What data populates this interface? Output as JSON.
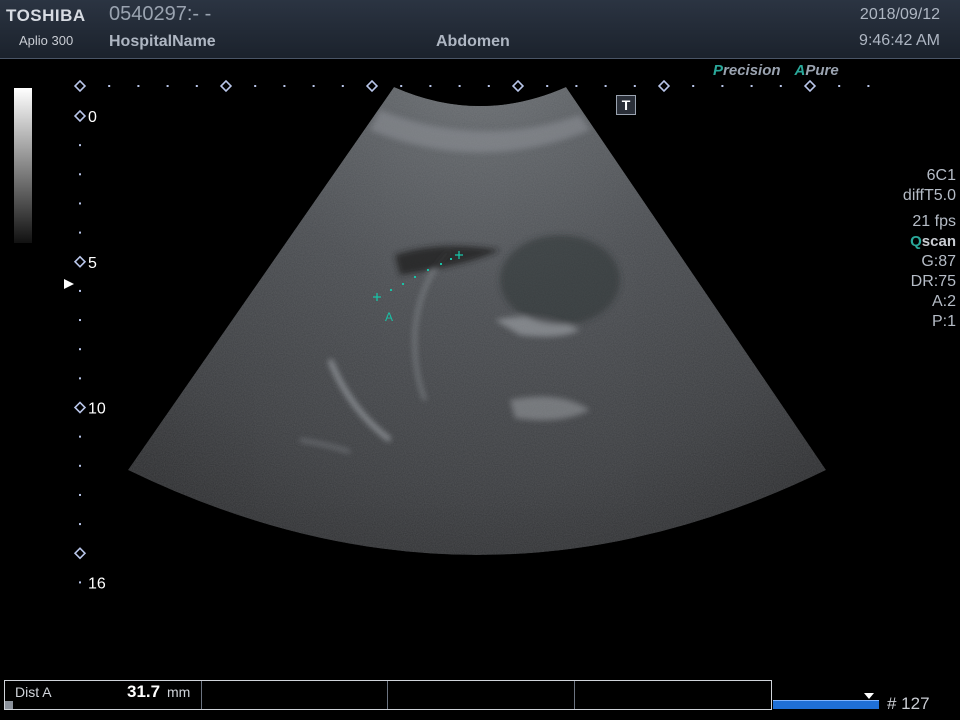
{
  "header": {
    "brand": "TOSHIBA",
    "model": "Aplio 300",
    "patient_id": "0540297:- -",
    "hospital": "HospitalName",
    "exam": "Abdomen",
    "date": "2018/09/12",
    "time": "9:46:42 AM"
  },
  "modes": {
    "precision_prefix": "P",
    "precision_rest": "recision",
    "apure_prefix": "A",
    "apure_rest": "Pure"
  },
  "t_marker": "T",
  "depth_scale": {
    "labels": [
      "0",
      "5",
      "10",
      "16"
    ],
    "unit_note": ""
  },
  "parameters": {
    "probe": "6C1",
    "mode": "diffT5.0",
    "frame_rate": "21 fps",
    "qscan_prefix": "Q",
    "qscan_rest": "scan",
    "gain": "G:87",
    "dynamic_range": "DR:75",
    "a_value": "A:2",
    "p_value": "P:1"
  },
  "measurement": {
    "caliper_label": "A",
    "label": "Dist A",
    "value": "31.7",
    "unit": "mm"
  },
  "cine": {
    "frame_label": "# 127"
  },
  "colors": {
    "caliper": "#19c2a6",
    "accent": "#2aa89a",
    "cine_bar": "#1f6fd6"
  }
}
